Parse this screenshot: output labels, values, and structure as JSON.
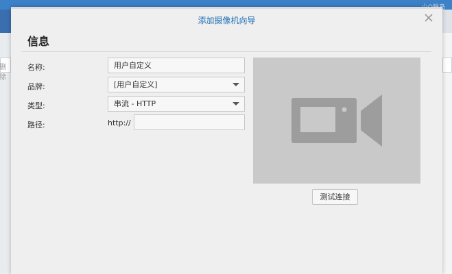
{
  "background": {
    "brand": "小Q鲜岛",
    "search_hint": "删除"
  },
  "dialog": {
    "title": "添加摄像机向导",
    "section_title": "信息",
    "form": {
      "name": {
        "label": "名称:",
        "value": "用户自定义"
      },
      "brand": {
        "label": "品牌:",
        "value": "[用户自定义]"
      },
      "type": {
        "label": "类型:",
        "value": "串流 - HTTP"
      },
      "path": {
        "label": "路径:",
        "prefix": "http://",
        "value": ""
      }
    },
    "preview": {
      "icon": "video-camera-icon"
    },
    "test_button": "测试连接",
    "close_icon": "close-icon"
  },
  "colors": {
    "title": "#1c6fb5",
    "preview_bg": "#c9c9c9",
    "camera_icon": "#9d9d9d",
    "top_bar": "#3d82c9"
  }
}
